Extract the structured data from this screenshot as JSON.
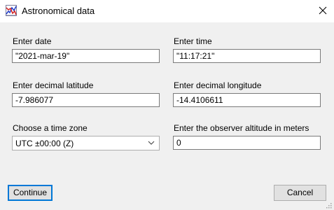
{
  "window": {
    "title": "Astronomical data",
    "app_icon": "chart-icon",
    "close_icon": "close-icon"
  },
  "form": {
    "date": {
      "label": "Enter date",
      "value": "\"2021-mar-19\""
    },
    "time": {
      "label": "Enter time",
      "value": "\"11:17:21\""
    },
    "latitude": {
      "label": "Enter decimal latitude",
      "value": "-7.986077"
    },
    "longitude": {
      "label": "Enter decimal longitude",
      "value": "-14.4106611"
    },
    "timezone": {
      "label": "Choose a time zone",
      "selected": "UTC ±00:00 (Z)"
    },
    "altitude": {
      "label": "Enter the observer altitude in meters",
      "value": "0"
    }
  },
  "buttons": {
    "continue": "Continue",
    "cancel": "Cancel"
  },
  "colors": {
    "background": "#f0f0f0",
    "focus_border": "#0078d7"
  }
}
